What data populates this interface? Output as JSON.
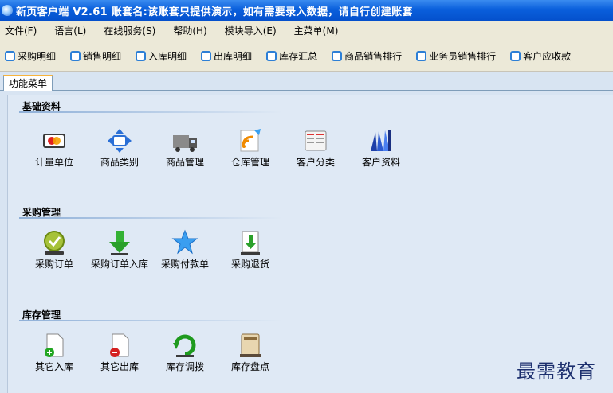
{
  "window": {
    "title": "新页客户端 V2.61   账套名:该账套只提供演示，如有需要录入数据，请自行创建账套"
  },
  "menubar": {
    "items": [
      {
        "label": "文件(F)"
      },
      {
        "label": "语言(L)"
      },
      {
        "label": "在线服务(S)"
      },
      {
        "label": "帮助(H)"
      },
      {
        "label": "模块导入(E)"
      },
      {
        "label": "主菜单(M)"
      }
    ]
  },
  "toolbar": {
    "items": [
      {
        "label": "采购明细"
      },
      {
        "label": "销售明细"
      },
      {
        "label": "入库明细"
      },
      {
        "label": "出库明细"
      },
      {
        "label": "库存汇总"
      },
      {
        "label": "商品销售排行"
      },
      {
        "label": "业务员销售排行"
      },
      {
        "label": "客户应收款"
      }
    ]
  },
  "tabs": [
    {
      "label": "功能菜单"
    }
  ],
  "sections": [
    {
      "title": "基础资料",
      "tiles": [
        {
          "label": "计量单位",
          "icon": "unit-icon"
        },
        {
          "label": "商品类别",
          "icon": "category-icon"
        },
        {
          "label": "商品管理",
          "icon": "truck-icon"
        },
        {
          "label": "仓库管理",
          "icon": "warehouse-icon"
        },
        {
          "label": "客户分类",
          "icon": "customer-category-icon"
        },
        {
          "label": "客户资料",
          "icon": "customer-data-icon"
        }
      ]
    },
    {
      "title": "采购管理",
      "tiles": [
        {
          "label": "采购订单",
          "icon": "check-icon"
        },
        {
          "label": "采购订单入库",
          "icon": "down-arrow-icon"
        },
        {
          "label": "采购付款单",
          "icon": "star-icon"
        },
        {
          "label": "采购退货",
          "icon": "return-doc-icon"
        }
      ]
    },
    {
      "title": "库存管理",
      "tiles": [
        {
          "label": "其它入库",
          "icon": "doc-plus-icon"
        },
        {
          "label": "其它出库",
          "icon": "doc-minus-icon"
        },
        {
          "label": "库存调拨",
          "icon": "refresh-icon"
        },
        {
          "label": "库存盘点",
          "icon": "book-icon"
        }
      ]
    }
  ],
  "watermark": "最需教育"
}
